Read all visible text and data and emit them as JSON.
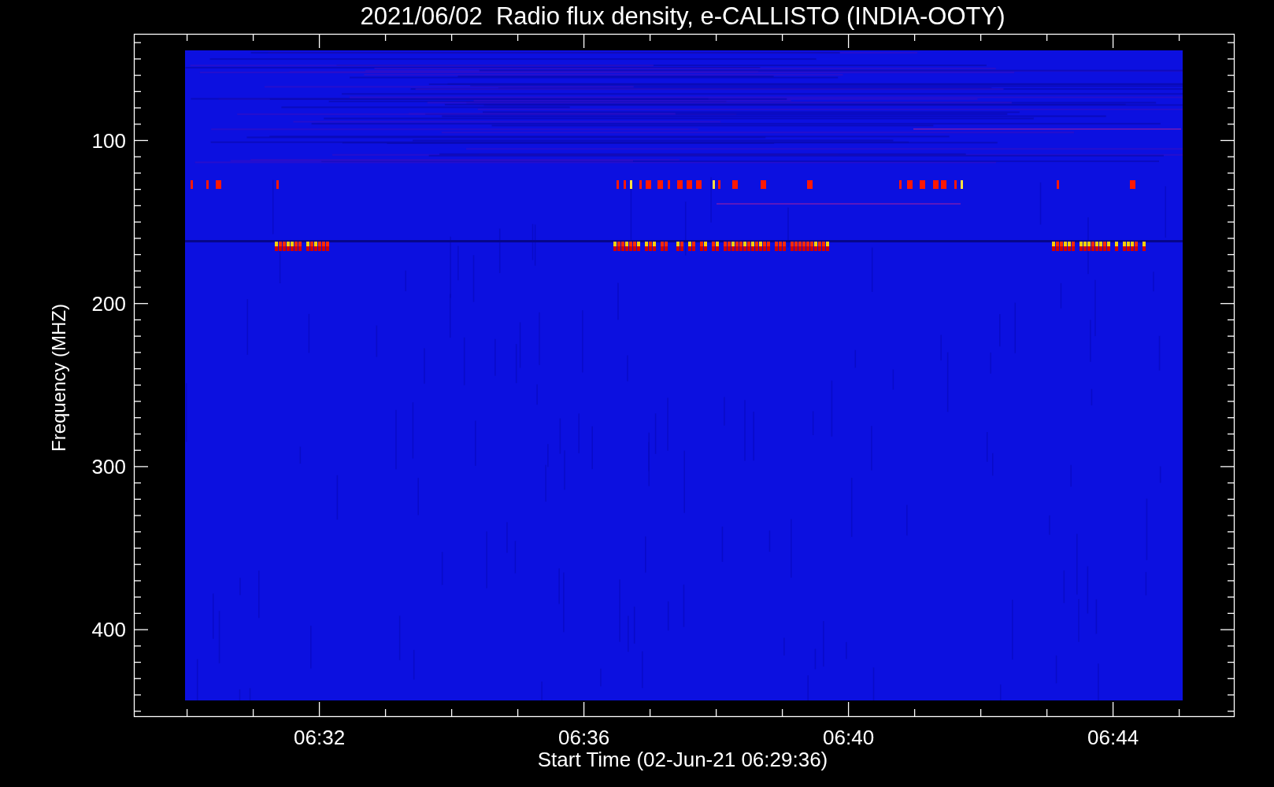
{
  "title": "2021/06/02  Radio flux density, e-CALLISTO (INDIA-OOTY)",
  "y_axis": {
    "label": "Frequency (MHZ)",
    "ticks": [
      "100",
      "200",
      "300",
      "400"
    ]
  },
  "x_axis": {
    "label": "Start Time (02-Jun-21 06:29:36)",
    "ticks": [
      "06:32",
      "06:36",
      "06:40",
      "06:44"
    ]
  }
}
